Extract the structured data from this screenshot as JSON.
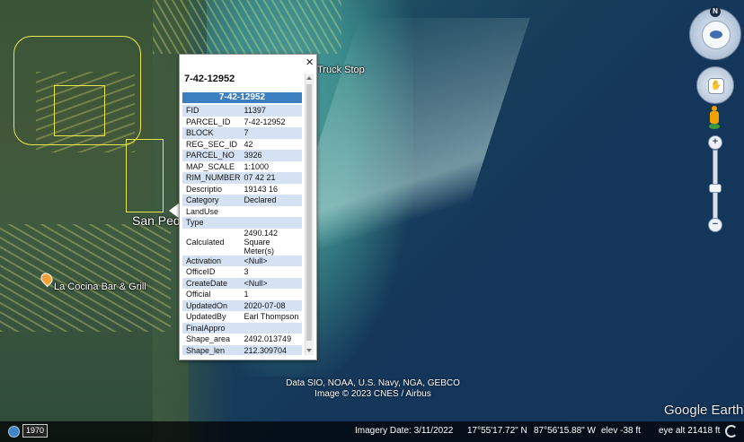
{
  "map": {
    "labels": {
      "truck_stop": "Truck Stop",
      "town": "San Pedro",
      "restaurant": "La Cocina Bar & Grill"
    },
    "attribution_line1": "Data SIO, NOAA, U.S. Navy, NGA, GEBCO",
    "attribution_line2": "Image © 2023 CNES / Airbus",
    "logo": "Google Earth"
  },
  "popup": {
    "title": "7-42-12952",
    "header": "7-42-12952",
    "close_label": "×",
    "rows": [
      {
        "k": "FID",
        "v": "11397"
      },
      {
        "k": "PARCEL_ID",
        "v": "7-42-12952"
      },
      {
        "k": "BLOCK",
        "v": "7"
      },
      {
        "k": "REG_SEC_ID",
        "v": "42"
      },
      {
        "k": "PARCEL_NO",
        "v": "3926"
      },
      {
        "k": "MAP_SCALE",
        "v": "1:1000"
      },
      {
        "k": "RIM_NUMBER",
        "v": "07 42 21"
      },
      {
        "k": "Descriptio",
        "v": "19143 16"
      },
      {
        "k": "Category",
        "v": "Declared"
      },
      {
        "k": "LandUse",
        "v": ""
      },
      {
        "k": "Type",
        "v": ""
      },
      {
        "k": "Calculated",
        "v": "2490.142 Square Meter(s)"
      },
      {
        "k": "Activation",
        "v": "<Null>"
      },
      {
        "k": "OfficeID",
        "v": "3"
      },
      {
        "k": "CreateDate",
        "v": "<Null>"
      },
      {
        "k": "Official",
        "v": "1"
      },
      {
        "k": "UpdatedOn",
        "v": "2020-07-08"
      },
      {
        "k": "UpdatedBy",
        "v": "Earl Thompson"
      },
      {
        "k": "FinalAppro",
        "v": ""
      },
      {
        "k": "Shape_area",
        "v": "2492.013749"
      },
      {
        "k": "Shape_len",
        "v": "212.309704"
      }
    ]
  },
  "nav": {
    "north_label": "N",
    "zoom_in": "+",
    "zoom_out": "−",
    "zoom_level_fraction": 0.6
  },
  "status": {
    "year": "1970",
    "imagery_date": "Imagery Date: 3/11/2022",
    "lat": "17°55'17.72\" N",
    "lon": "87°56'15.88\" W",
    "elev": "elev   -38 ft",
    "eye_alt": "eye alt  21418 ft"
  }
}
